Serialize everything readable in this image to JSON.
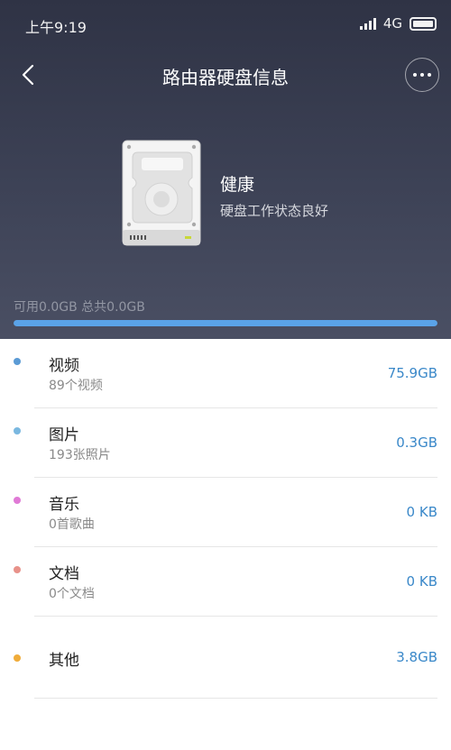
{
  "status_bar": {
    "time": "上午9:19",
    "network": "4G"
  },
  "nav": {
    "title": "路由器硬盘信息"
  },
  "disk": {
    "health_title": "健康",
    "health_desc": "硬盘工作状态良好",
    "capacity_text": "可用0.0GB 总共0.0GB",
    "used_fraction": 1.0
  },
  "categories": [
    {
      "name": "视频",
      "sub": "89个视频",
      "size": "75.9GB",
      "color": "#5b9bd5"
    },
    {
      "name": "图片",
      "sub": "193张照片",
      "size": "0.3GB",
      "color": "#7ab8e0"
    },
    {
      "name": "音乐",
      "sub": "0首歌曲",
      "size": "0 KB",
      "color": "#e07ad6"
    },
    {
      "name": "文档",
      "sub": "0个文档",
      "size": "0 KB",
      "color": "#e8928a"
    },
    {
      "name": "其他",
      "sub": "",
      "size": "3.8GB",
      "color": "#f0ac3a"
    }
  ],
  "icons": {
    "back": "chevron-left-icon",
    "more": "more-horizontal-icon",
    "disk": "hard-drive-icon",
    "signal": "signal-icon",
    "battery": "battery-icon"
  }
}
